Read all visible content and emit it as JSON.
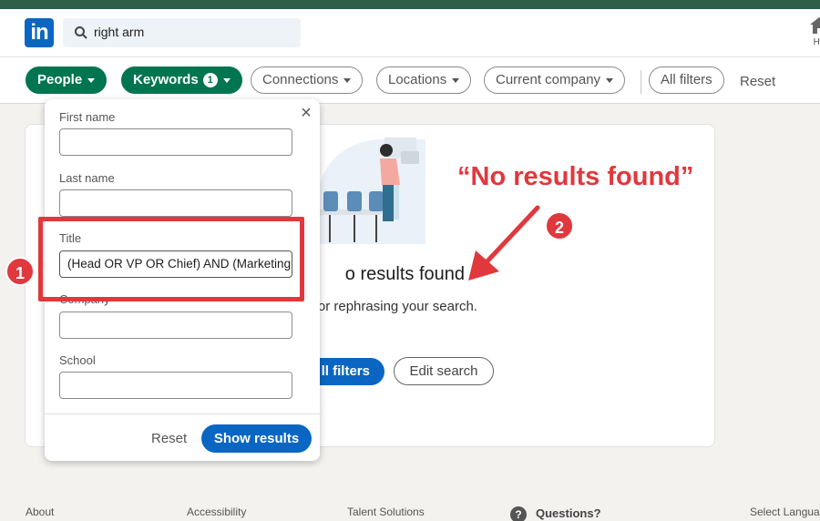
{
  "nav": {
    "logo_text": "in",
    "search_value": "right arm",
    "home_label": "Ho"
  },
  "filters": {
    "people": "People",
    "keywords": "Keywords",
    "keywords_count": "1",
    "connections": "Connections",
    "locations": "Locations",
    "current_company": "Current company",
    "all_filters": "All filters",
    "reset": "Reset"
  },
  "dropdown": {
    "first_name_label": "First name",
    "first_name_value": "",
    "last_name_label": "Last name",
    "last_name_value": "",
    "title_label": "Title",
    "title_value": "(Head OR VP OR Chief) AND (Marketing",
    "company_label": "Company",
    "company_value": "",
    "school_label": "School",
    "school_value": "",
    "reset_label": "Reset",
    "show_results_label": "Show results",
    "close_glyph": "×"
  },
  "results": {
    "title": "o results found",
    "subtitle": "ng filters or rephrasing your search.",
    "all_filters_btn": "ll filters",
    "edit_search_btn": "Edit search"
  },
  "annotations": {
    "callout_text": "“No results found”",
    "num1": "1",
    "num2": "2",
    "color": "#e0383d"
  },
  "footer": {
    "about": "About",
    "accessibility": "Accessibility",
    "talent": "Talent Solutions",
    "questions": "Questions?",
    "question_glyph": "?",
    "language": "Select Language"
  },
  "colors": {
    "brand": "#0a66c2",
    "active_pill": "#01754f",
    "top_strip": "#2d5f4a"
  }
}
